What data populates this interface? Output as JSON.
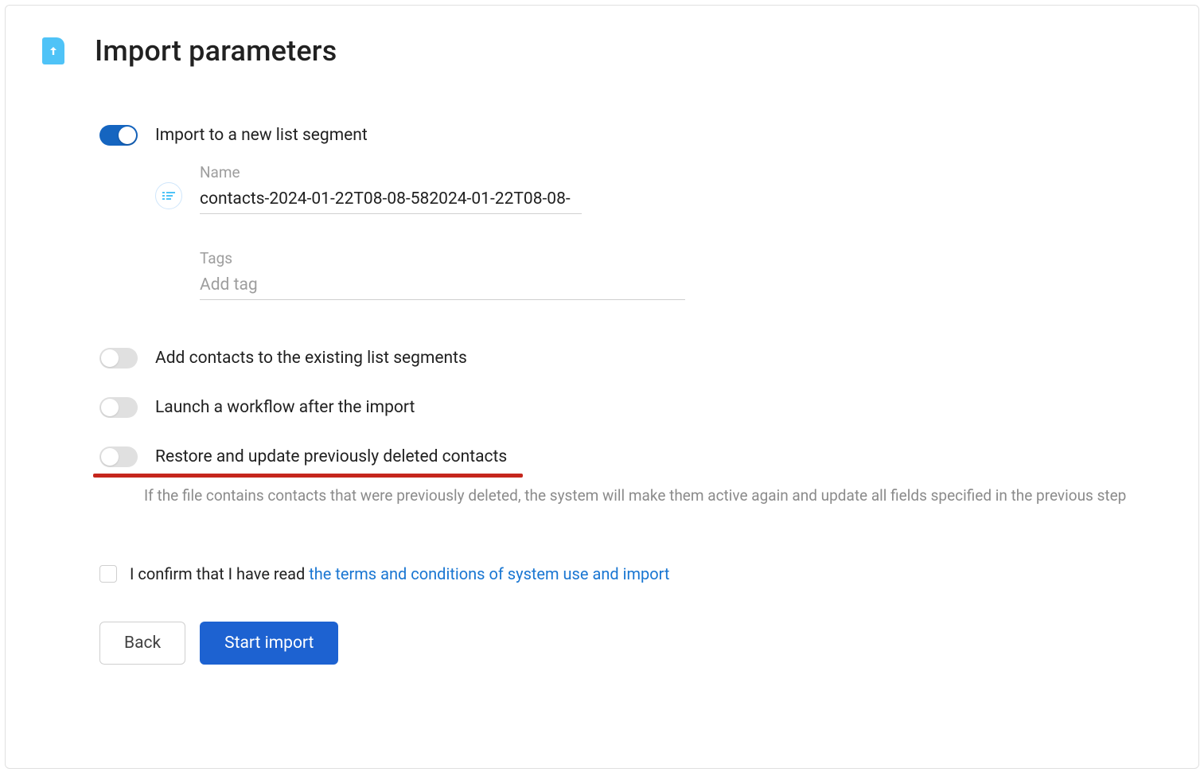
{
  "header": {
    "title": "Import parameters"
  },
  "toggles": {
    "newSegment": {
      "label": "Import to a new list segment",
      "on": true,
      "nameLabel": "Name",
      "nameValue": "contacts-2024-01-22T08-08-582024-01-22T08-08-",
      "tagsLabel": "Tags",
      "tagsPlaceholder": "Add tag"
    },
    "addExisting": {
      "label": "Add contacts to the existing list segments",
      "on": false
    },
    "launchWorkflow": {
      "label": "Launch a workflow after the import",
      "on": false
    },
    "restoreDeleted": {
      "label": "Restore and update previously deleted contacts",
      "on": false,
      "description": "If the file contains contacts that were previously deleted, the system will make them active again and update all fields specified in the previous step"
    }
  },
  "confirm": {
    "checked": false,
    "textPrefix": "I confirm that I have read ",
    "linkText": "the terms and conditions of system use and import"
  },
  "buttons": {
    "back": "Back",
    "start": "Start import"
  }
}
